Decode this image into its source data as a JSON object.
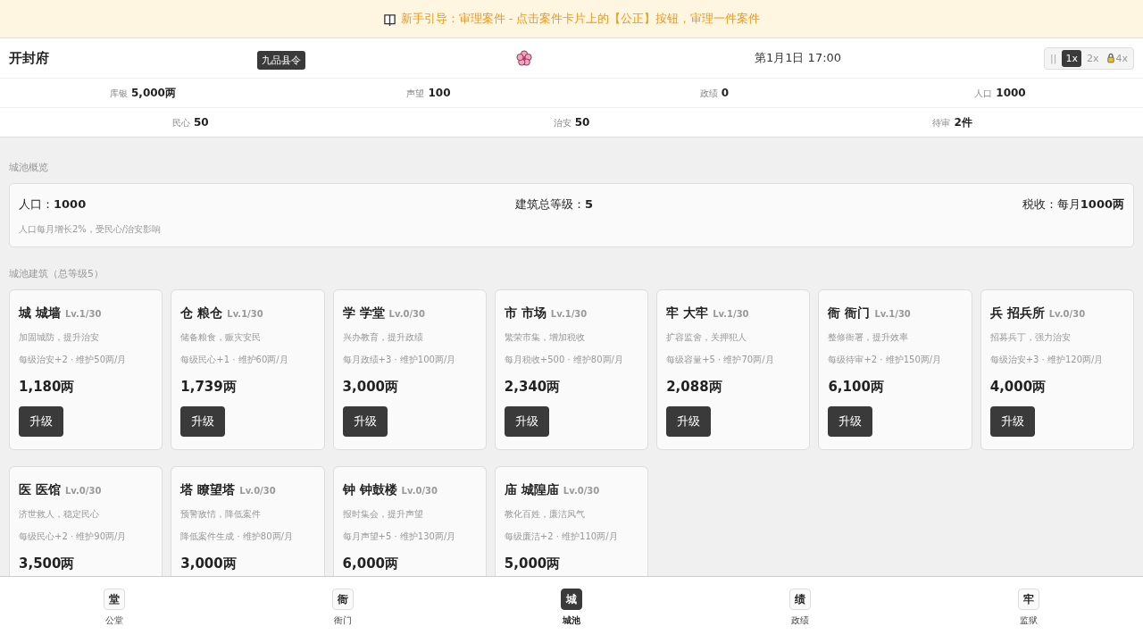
{
  "banner": {
    "text": "新手引导：审理案件 - 点击案件卡片上的【公正】按钮，审理一件案件"
  },
  "header": {
    "title": "开封府",
    "rank": "九品县令",
    "date": "第1月1日 17:00",
    "speed": [
      {
        "kind": "pause",
        "label": "||",
        "selected": false,
        "locked": false
      },
      {
        "kind": "speed",
        "label": "1x",
        "selected": true,
        "locked": false
      },
      {
        "kind": "speed",
        "label": "2x",
        "selected": false,
        "locked": false
      },
      {
        "kind": "speed",
        "label": "4x",
        "selected": false,
        "locked": true
      }
    ]
  },
  "stats_row_1": [
    {
      "label": "库银",
      "value": "5,000两"
    },
    {
      "label": "声望",
      "value": "100"
    },
    {
      "label": "政绩",
      "value": "0"
    },
    {
      "label": "人口",
      "value": "1000"
    }
  ],
  "stats_row_2": [
    {
      "label": "民心",
      "value": "50"
    },
    {
      "label": "治安",
      "value": "50"
    },
    {
      "label": "待审",
      "value": "2件"
    }
  ],
  "overview": {
    "heading": "城池概览",
    "items": [
      {
        "label": "人口：",
        "value": "1000"
      },
      {
        "label": "建筑总等级：",
        "value": "5"
      },
      {
        "label": "税收：每月",
        "value": "1000两"
      }
    ],
    "note": "人口每月增长2%，受民心/治安影响"
  },
  "buildings": {
    "heading": "城池建筑（总等级5）",
    "cards": [
      {
        "icon": "城",
        "name": "城墙",
        "level": "Lv.1/30",
        "desc": "加固城防，提升治安",
        "effect": "每级治安+2 · 维护50两/月",
        "price": "1,180两",
        "button": "升级"
      },
      {
        "icon": "仓",
        "name": "粮仓",
        "level": "Lv.1/30",
        "desc": "储备粮食，赈灾安民",
        "effect": "每级民心+1 · 维护60两/月",
        "price": "1,739两",
        "button": "升级"
      },
      {
        "icon": "学",
        "name": "学堂",
        "level": "Lv.0/30",
        "desc": "兴办教育，提升政绩",
        "effect": "每月政绩+3 · 维护100两/月",
        "price": "3,000两",
        "button": "升级"
      },
      {
        "icon": "市",
        "name": "市场",
        "level": "Lv.1/30",
        "desc": "繁荣市集，增加税收",
        "effect": "每月税收+500 · 维护80两/月",
        "price": "2,340两",
        "button": "升级"
      },
      {
        "icon": "牢",
        "name": "大牢",
        "level": "Lv.1/30",
        "desc": "扩容监舍，关押犯人",
        "effect": "每级容量+5 · 维护70两/月",
        "price": "2,088两",
        "button": "升级"
      },
      {
        "icon": "衙",
        "name": "衙门",
        "level": "Lv.1/30",
        "desc": "整修衙署，提升效率",
        "effect": "每级待审+2 · 维护150两/月",
        "price": "6,100两",
        "button": "升级"
      },
      {
        "icon": "兵",
        "name": "招兵所",
        "level": "Lv.0/30",
        "desc": "招募兵丁，强力治安",
        "effect": "每级治安+3 · 维护120两/月",
        "price": "4,000两",
        "button": "升级"
      },
      {
        "icon": "医",
        "name": "医馆",
        "level": "Lv.0/30",
        "desc": "济世救人，稳定民心",
        "effect": "每级民心+2 · 维护90两/月",
        "price": "3,500两"
      },
      {
        "icon": "塔",
        "name": "瞭望塔",
        "level": "Lv.0/30",
        "desc": "预警敌情，降低案件",
        "effect": "降低案件生成 · 维护80两/月",
        "price": "3,000两"
      },
      {
        "icon": "钟",
        "name": "钟鼓楼",
        "level": "Lv.0/30",
        "desc": "报时集会，提升声望",
        "effect": "每月声望+5 · 维护130两/月",
        "price": "6,000两"
      },
      {
        "icon": "庙",
        "name": "城隍庙",
        "level": "Lv.0/30",
        "desc": "教化百姓，廉洁风气",
        "effect": "每级廉洁+2 · 维护110两/月",
        "price": "5,000两"
      }
    ]
  },
  "nav": [
    {
      "icon": "堂",
      "label": "公堂",
      "selected": false
    },
    {
      "icon": "衙",
      "label": "衙门",
      "selected": false
    },
    {
      "icon": "城",
      "label": "城池",
      "selected": true
    },
    {
      "icon": "绩",
      "label": "政绩",
      "selected": false
    },
    {
      "icon": "牢",
      "label": "监狱",
      "selected": false
    }
  ]
}
